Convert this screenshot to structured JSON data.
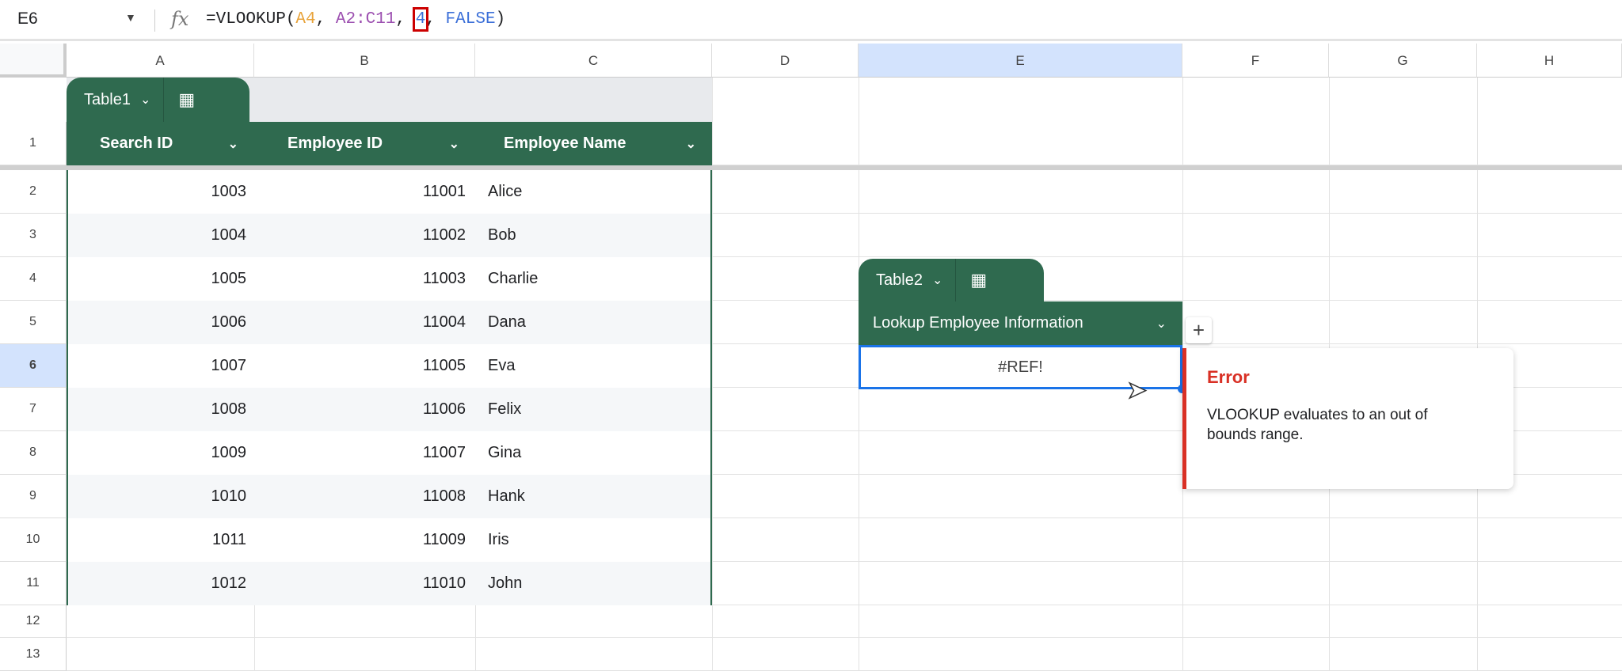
{
  "formula_bar": {
    "name_box": "E6",
    "fx": "fx",
    "formula_prefix": "=VLOOKUP(",
    "arg1": "A4",
    "sep1": ", ",
    "arg2": "A2:C11",
    "sep2": ", ",
    "arg3": "4",
    "sep3": ", ",
    "arg4": "FALSE",
    "suffix": ")"
  },
  "columns": [
    "A",
    "B",
    "C",
    "D",
    "E",
    "F",
    "G",
    "H"
  ],
  "rows": [
    "1",
    "2",
    "3",
    "4",
    "5",
    "6",
    "7",
    "8",
    "9",
    "10",
    "11",
    "12",
    "13"
  ],
  "table1": {
    "name": "Table1",
    "headers": [
      "Search ID",
      "Employee ID",
      "Employee Name"
    ],
    "rows": [
      [
        "1003",
        "11001",
        "Alice"
      ],
      [
        "1004",
        "11002",
        "Bob"
      ],
      [
        "1005",
        "11003",
        "Charlie"
      ],
      [
        "1006",
        "11004",
        "Dana"
      ],
      [
        "1007",
        "11005",
        "Eva"
      ],
      [
        "1008",
        "11006",
        "Felix"
      ],
      [
        "1009",
        "11007",
        "Gina"
      ],
      [
        "1010",
        "11008",
        "Hank"
      ],
      [
        "1011",
        "11009",
        "Iris"
      ],
      [
        "1012",
        "11010",
        "John"
      ]
    ]
  },
  "table2": {
    "name": "Table2",
    "header": "Lookup Employee Information",
    "value": "#REF!",
    "add": "+"
  },
  "error_popup": {
    "title": "Error",
    "message": "VLOOKUP evaluates to an out of bounds range."
  },
  "colors": {
    "table_green": "#2f6a4f",
    "error_red": "#d93025",
    "selection_blue": "#1a73e8"
  }
}
